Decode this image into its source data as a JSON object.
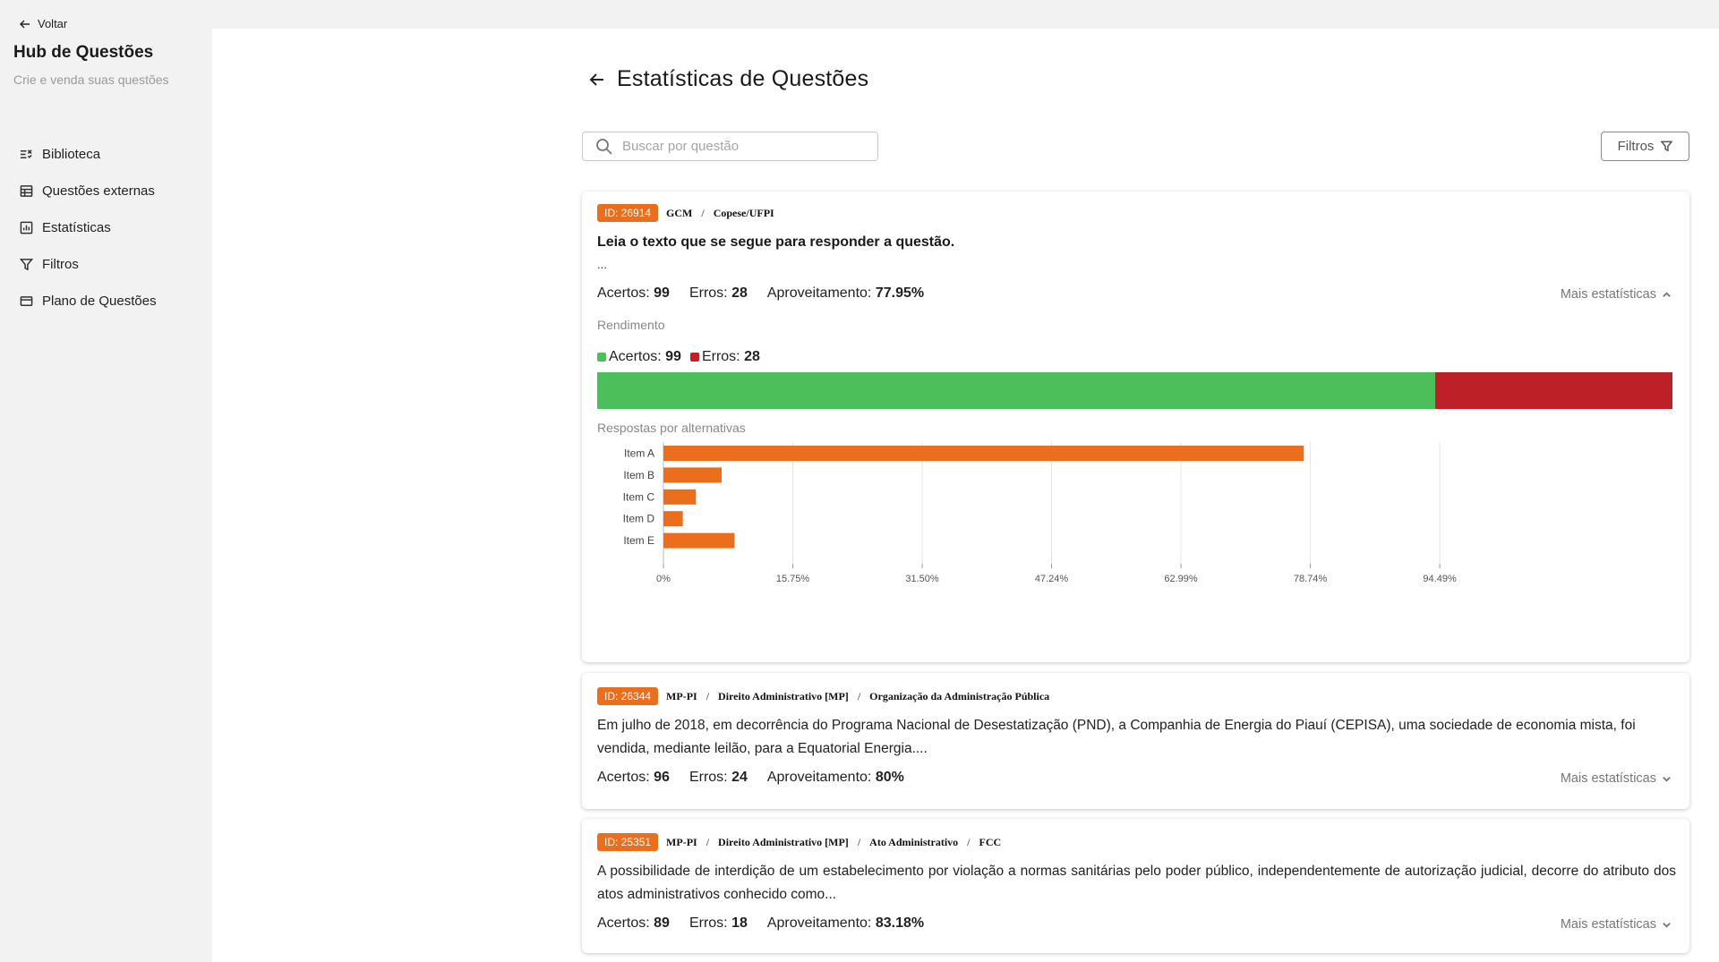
{
  "sidebar": {
    "back_label": "Voltar",
    "title": "Hub de Questões",
    "subtitle": "Crie e venda suas questões",
    "items": [
      {
        "label": "Biblioteca",
        "icon": "list-check-icon"
      },
      {
        "label": "Questões externas",
        "icon": "table-icon"
      },
      {
        "label": "Estatísticas",
        "icon": "bar-chart-icon"
      },
      {
        "label": "Filtros",
        "icon": "funnel-icon"
      },
      {
        "label": "Plano de Questões",
        "icon": "credit-card-icon"
      }
    ]
  },
  "header": {
    "title": "Estatísticas de Questões",
    "search_placeholder": "Buscar por questão",
    "filters_label": "Filtros"
  },
  "labels": {
    "acertos": "Acertos:",
    "erros": "Erros:",
    "aproveitamento": "Aproveitamento:",
    "more_stats": "Mais estatísticas",
    "rendimento": "Rendimento",
    "respostas": "Respostas por alternativas"
  },
  "colors": {
    "accent_orange": "#ea6e1c",
    "success_green": "#4cbf5a",
    "error_red": "#bd2027"
  },
  "questions": [
    {
      "id": "ID: 26914",
      "path": [
        "GCM",
        "Copese/UFPI"
      ],
      "heading": "Leia o texto que se segue para responder a questão.",
      "text": "...",
      "acertos": "99",
      "erros": "28",
      "aproveitamento": "77.95%",
      "expanded": true
    },
    {
      "id": "ID: 26344",
      "path": [
        "MP-PI",
        "Direito Administrativo [MP]",
        "Organização da Administração Pública"
      ],
      "text": "Em julho de 2018, em decorrência do Programa Nacional de Desestatização (PND), a Companhia de Energia do Piauí (CEPISA), uma sociedade de economia mista, foi vendida, mediante leilão, para a Equatorial Energia....",
      "acertos": "96",
      "erros": "24",
      "aproveitamento": "80%",
      "expanded": false
    },
    {
      "id": "ID: 25351",
      "path": [
        "MP-PI",
        "Direito Administrativo [MP]",
        "Ato Administrativo",
        "FCC"
      ],
      "text": "A possibilidade de interdição de um estabelecimento por violação a normas sanitárias pelo poder público, independentemente de autorização judicial, decorre do atributo dos atos administrativos conhecido como...",
      "acertos": "89",
      "erros": "18",
      "aproveitamento": "83.18%",
      "expanded": false
    }
  ],
  "chart_data": [
    {
      "type": "bar",
      "orientation": "horizontal-stacked",
      "categories": [
        "Rendimento"
      ],
      "series": [
        {
          "name": "Acertos",
          "values": [
            99
          ],
          "color": "#4cbf5a"
        },
        {
          "name": "Erros",
          "values": [
            28
          ],
          "color": "#bd2027"
        }
      ],
      "legend": "top-left"
    },
    {
      "type": "bar",
      "orientation": "horizontal",
      "categories": [
        "Item A",
        "Item B",
        "Item C",
        "Item D",
        "Item E"
      ],
      "values": [
        77.95,
        7.09,
        3.94,
        2.36,
        8.66
      ],
      "color": "#ea6e1c",
      "xticks": [
        "0%",
        "15.75%",
        "31.50%",
        "47.24%",
        "62.99%",
        "78.74%",
        "94.49%"
      ],
      "xtick_values": [
        0,
        15.75,
        31.5,
        47.24,
        62.99,
        78.74,
        94.49
      ],
      "xlim": [
        0,
        102
      ],
      "grid": "vertical"
    }
  ]
}
